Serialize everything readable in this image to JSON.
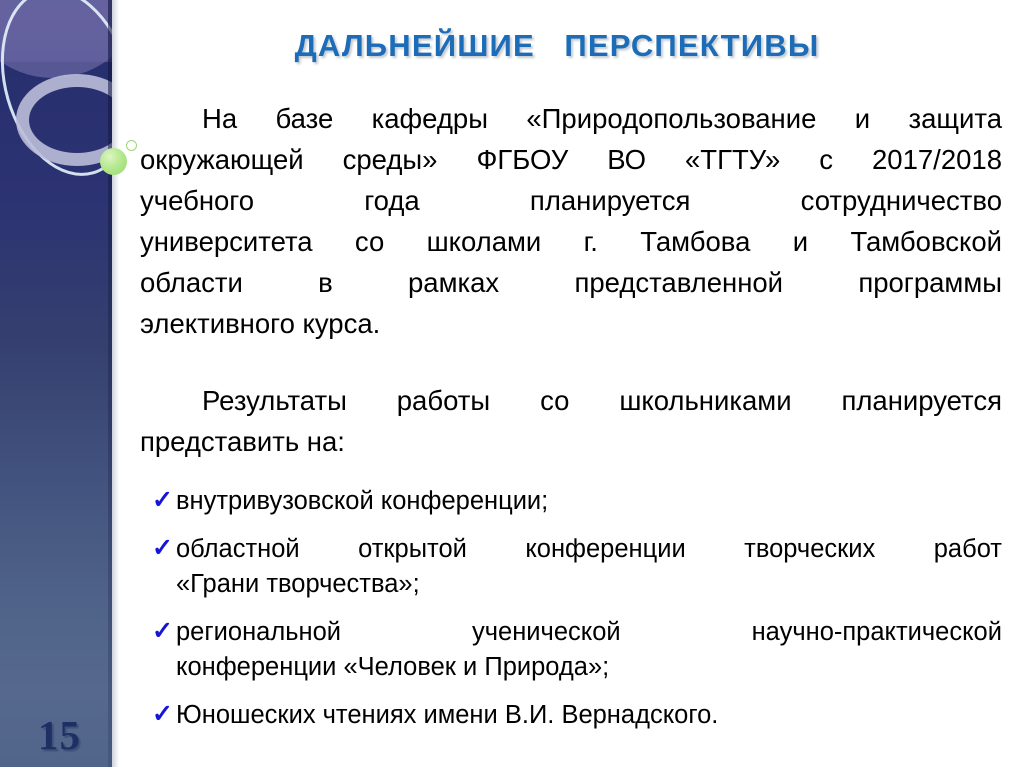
{
  "slide": {
    "title": "ДАЛЬНЕЙШИЕ   ПЕРСПЕКТИВЫ",
    "page_number": "15",
    "title_color": "#1d6cb7",
    "check_color": "#1515d8",
    "sidebar_navy": "#2c3372",
    "sidebar_purple": "#5c5796",
    "sidebar_bottom": "#51648a",
    "accent_green": "#b9e994"
  },
  "paragraphs": [
    {
      "name": "paragraph-1",
      "lines": [
        "На базе кафедры «Природопользование и защита",
        "окружающей среды» ФГБОУ ВО «ТГТУ» с 2017/2018",
        "учебного года планируется сотрудничество",
        "университета со школами г. Тамбова и Тамбовской",
        "области в рамках представленной программы",
        "элективного курса."
      ]
    },
    {
      "name": "paragraph-2",
      "lines": [
        "Результаты работы со школьниками планируется",
        "представить на:"
      ]
    }
  ],
  "list": {
    "bullet_glyph": "✓",
    "items": [
      {
        "name": "list-item-1",
        "lines": [
          "внутривузовской конференции;"
        ]
      },
      {
        "name": "list-item-2",
        "lines": [
          "областной открытой конференции творческих работ",
          "«Грани творчества»;"
        ]
      },
      {
        "name": "list-item-3",
        "lines": [
          "региональной ученической научно-практической",
          "конференции «Человек и Природа»;"
        ]
      },
      {
        "name": "list-item-4",
        "lines": [
          "Юношеских чтениях имени В.И. Вернадского."
        ]
      }
    ]
  }
}
